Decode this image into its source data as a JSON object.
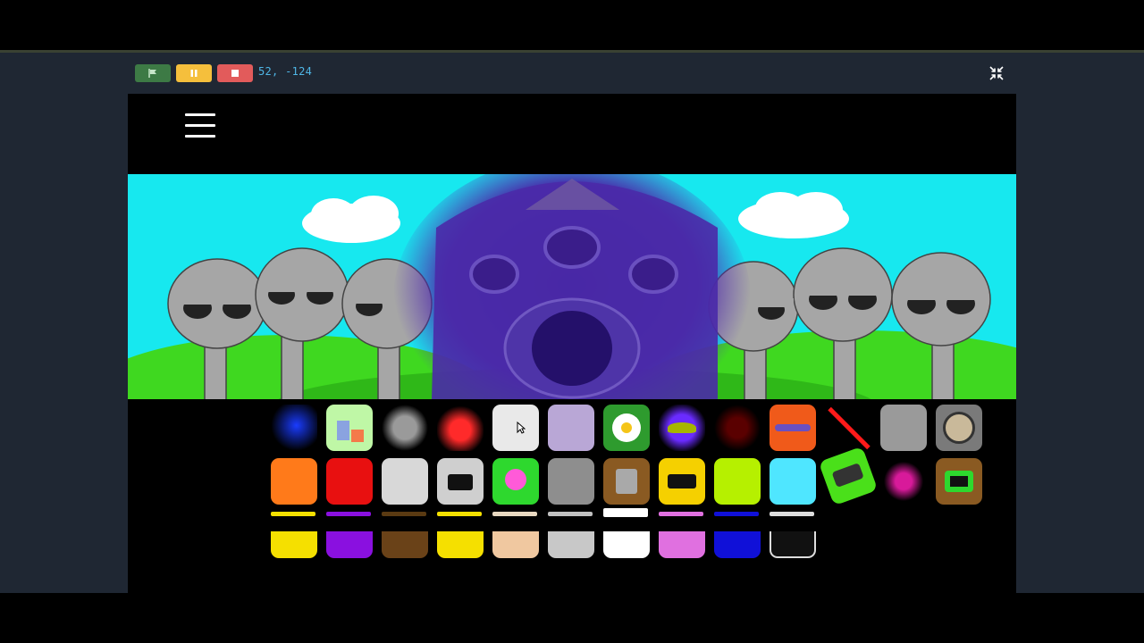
{
  "toolbar": {
    "coords": "52, -124",
    "green_flag_icon": "flag-icon",
    "pause_icon": "pause-icon",
    "stop_icon": "stop-icon",
    "fullscreen_icon": "exit-fullscreen-icon"
  },
  "stage": {
    "menu_icon": "hamburger-menu-icon"
  },
  "colors": {
    "sky": "#17e8ef",
    "grass": "#3fd820",
    "character_grey": "#a6a6a6",
    "overlay_purple": "#4a22a6",
    "flag_button": "#3d7a45",
    "pause_button": "#f5bf3c",
    "stop_button": "#e25b5b",
    "coords_text": "#4fb6e6"
  },
  "tray": {
    "row1": [
      "blue-swirl-icon",
      "gift-boxes-icon",
      "grey-orb-icon",
      "red-light-icon",
      "white-cloud-icon",
      "lavender-block-icon",
      "white-flower-icon",
      "green-ufo-icon",
      "red-visor-icon",
      "orange-saturn-icon",
      "red-stick-icon",
      "grey-cat-ears-icon",
      "roulette-wheel-icon"
    ],
    "row2": [
      "orange-horns-icon",
      "red-crown-icon",
      "silver-gear-icon",
      "robot-screen-icon",
      "pink-flower-icon",
      "grey-ears-icon",
      "brown-bag-icon",
      "yellow-screen-icon",
      "lime-spiky-icon",
      "cyan-headphones-icon",
      "green-speaker-icon",
      "pink-candy-icon",
      "green-tv-icon"
    ],
    "row3": [
      "yellow-bunting-icon",
      "purple-block-icon",
      "brown-crate-icon",
      "yellow-block-icon",
      "beige-block-icon",
      "silver-keyboard-icon",
      "white-block-icon",
      "pink-block-icon",
      "blue-block-icon",
      "black-outline-icon"
    ]
  }
}
